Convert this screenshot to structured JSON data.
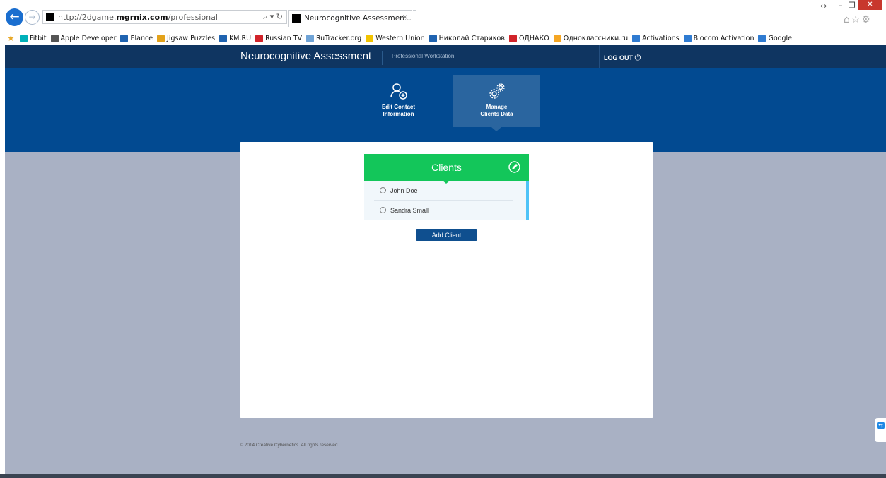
{
  "browser": {
    "url_prefix": "http://2dgame.",
    "url_domain": "mgrnix.com",
    "url_path": "/professional",
    "address_icons": "⌕ ▾ ↻",
    "tab_title": "Neurocognitive Assessmen...",
    "tab_close": "×",
    "favorites": [
      {
        "label": "Fitbit",
        "color": "#00b0b9"
      },
      {
        "label": "Apple Developer",
        "color": "#555555"
      },
      {
        "label": "Elance",
        "color": "#1f63b0"
      },
      {
        "label": "Jigsaw Puzzles",
        "color": "#e3a21a"
      },
      {
        "label": "KM.RU",
        "color": "#1f63b0"
      },
      {
        "label": "Russian TV",
        "color": "#d1232a"
      },
      {
        "label": "RuTracker.org",
        "color": "#6fa3d6"
      },
      {
        "label": "Western Union",
        "color": "#f2c300"
      },
      {
        "label": "Николай Стариков",
        "color": "#1f63b0"
      },
      {
        "label": "ОДНАКО",
        "color": "#d1232a"
      },
      {
        "label": "Одноклассники.ru",
        "color": "#f5a623"
      },
      {
        "label": "Activations",
        "color": "#2f7bd1"
      },
      {
        "label": "Biocom Activation",
        "color": "#2f7bd1"
      },
      {
        "label": "Google",
        "color": "#2f7bd1"
      }
    ]
  },
  "header": {
    "brand": "Neurocognitive Assessment",
    "subtitle": "Professional Workstation",
    "logout_label": "LOG OUT"
  },
  "nav": {
    "items": [
      {
        "line1": "Edit Contact",
        "line2": "Information",
        "icon": "add-contact-icon"
      },
      {
        "line1": "Manage",
        "line2": "Clients Data",
        "icon": "gears-icon",
        "active": true
      }
    ]
  },
  "clients": {
    "title": "Clients",
    "items": [
      "John Doe",
      "Sandra Small"
    ],
    "add_button": "Add Client"
  },
  "footer": {
    "text": "© 2014 Creative Cybernetics. All rights reserved."
  },
  "colors": {
    "header_bg": "#0f3561",
    "nav_bg": "#024a91",
    "active_nav_bg": "#2a659f",
    "content_bg": "#a9b1c4",
    "clients_green": "#13c65a",
    "add_button_bg": "#0f4f8f"
  }
}
